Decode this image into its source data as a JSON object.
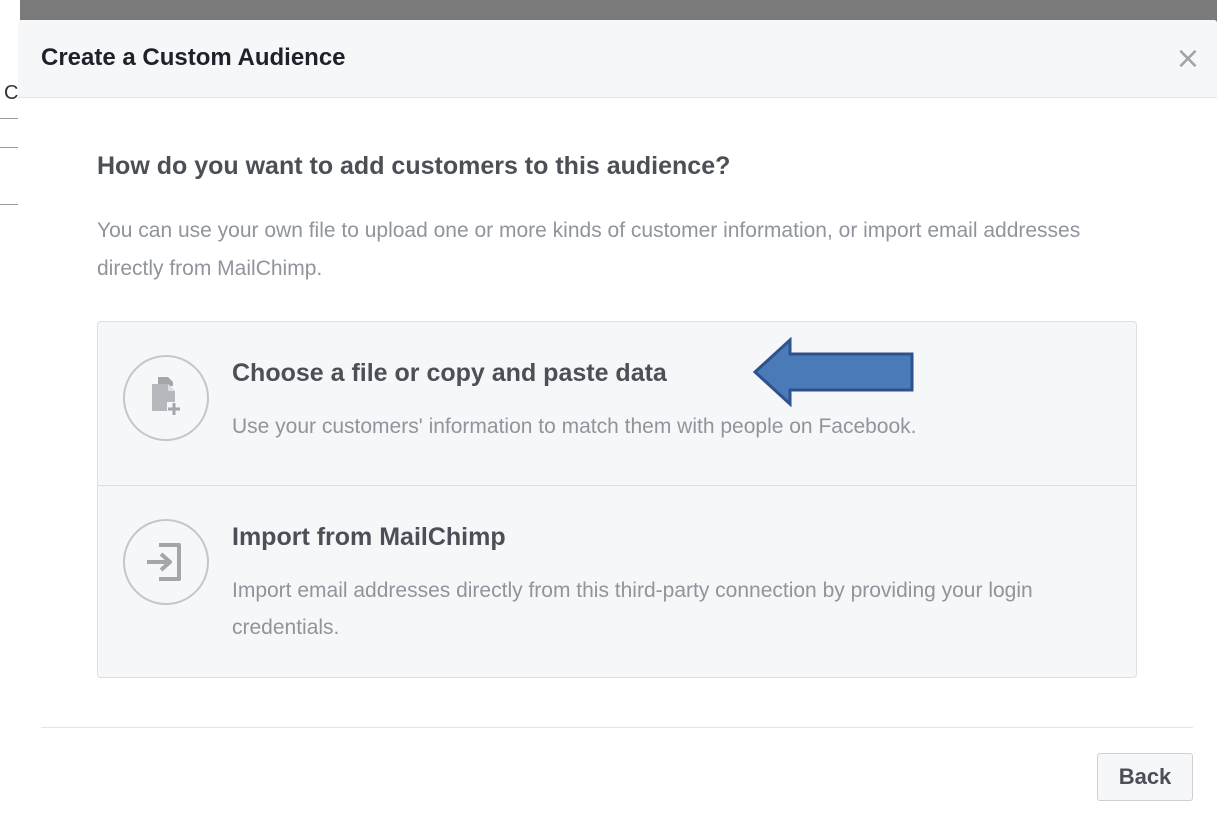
{
  "dialog": {
    "title": "Create a Custom Audience",
    "close_glyph": "×"
  },
  "background": {
    "peek_char": "C"
  },
  "content": {
    "question": "How do you want to add customers to this audience?",
    "intro": "You can use your own file to upload one or more kinds of customer information, or import email addresses directly from MailChimp."
  },
  "options": [
    {
      "icon": "file-add-icon",
      "title": "Choose a file or copy and paste data",
      "description": "Use your customers' information to match them with people on Facebook."
    },
    {
      "icon": "import-icon",
      "title": "Import from MailChimp",
      "description": "Import email addresses directly from this third-party connection by providing your login credentials."
    }
  ],
  "annotation": {
    "icon": "left-arrow-icon",
    "fill_color": "#4a7ab8",
    "stroke_color": "#2f528f"
  },
  "footer": {
    "back_label": "Back"
  },
  "colors": {
    "overlay": "#7a7a7a",
    "header_bg": "#f6f7f9",
    "title_text": "#1d2129",
    "body_text": "#4b4f56",
    "muted_text": "#90949c",
    "border": "#dddfe2"
  }
}
